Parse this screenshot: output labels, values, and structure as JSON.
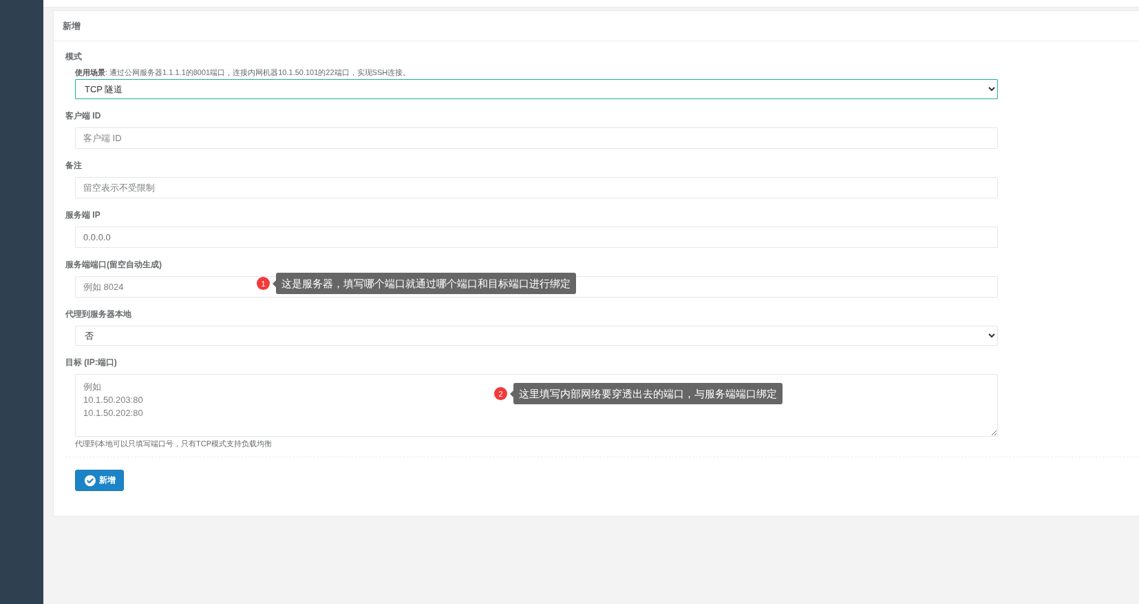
{
  "panel": {
    "title": "新增"
  },
  "fields": [
    {
      "kind": "select",
      "label": "模式",
      "hint": "**使用场景**: 通过公网服务器1.1.1.1的8001端口，连接内网机器10.1.50.101的22端口，实现SSH连接。",
      "value": "TCP 隧道",
      "focused": true
    },
    {
      "kind": "input",
      "label": "客户端 ID",
      "placeholder": "客户端 ID",
      "focused": false
    },
    {
      "kind": "input",
      "label": "备注",
      "placeholder": "留空表示不受限制",
      "focused": false
    },
    {
      "kind": "input",
      "label": "服务端 IP",
      "value": "0.0.0.0",
      "focused": false
    },
    {
      "kind": "input",
      "label": "服务端端口(留空自动生成)",
      "placeholder": "例如 8024",
      "focused": false,
      "annotation": {
        "number": "1",
        "text": "这是服务器，填写哪个端口就通过哪个端口和目标端口进行绑定"
      }
    },
    {
      "kind": "select",
      "label": "代理到服务器本地",
      "value": "否",
      "focused": false
    },
    {
      "kind": "textarea",
      "label": "目标 (IP:端口)",
      "placeholder": "例如\n10.1.50.203:80\n10.1.50.202:80",
      "focused": false,
      "annotation": {
        "number": "2",
        "text": "这里填写内部网络要穿透出去的端口，与服务端端口绑定"
      },
      "footnote": "代理到本地可以只填写端口号，只有TCP模式支持负载均衡"
    }
  ],
  "submit": {
    "label": "新增"
  }
}
